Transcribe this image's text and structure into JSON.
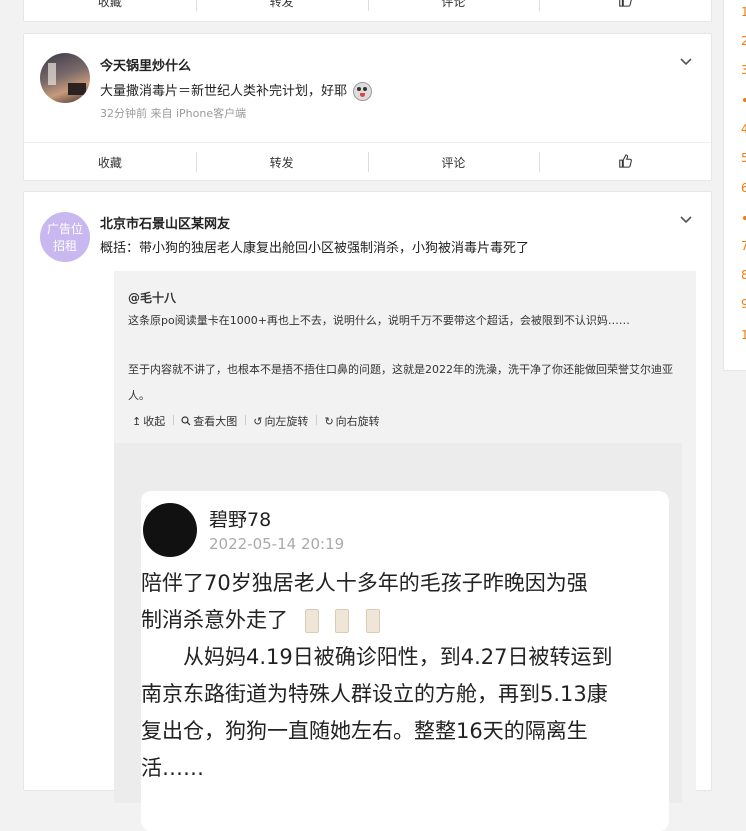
{
  "top_card": {
    "actions": [
      "收藏",
      "转发",
      "评论"
    ]
  },
  "post1": {
    "author": "今天锅里炒什么",
    "text": "大量撒消毒片＝新世纪人类补完计划，好耶",
    "meta": "32分钟前  来自 iPhone客户端",
    "actions": [
      "收藏",
      "转发",
      "评论"
    ]
  },
  "post2": {
    "author": "北京市石景山区某网友",
    "avatar_badge": "广告位招租",
    "text": "概括：带小狗的独居老人康复出舱回小区被强制消杀，小狗被消毒片毒死了",
    "repost": {
      "author": "@毛十八",
      "line1": "这条原po阅读量卡在1000+再也上不去，说明什么，说明千万不要带这个超话，会被限到不认识妈……",
      "line2": "至于内容就不讲了，也根本不是捂不捂住口鼻的问题，这就是2022年的洗澡，洗干净了你还能做回荣誉艾尔迪亚人。",
      "toolbar": [
        "收起",
        "查看大图",
        "向左旋转",
        "向右旋转"
      ],
      "image": {
        "name": "碧野78",
        "time": "2022-05-14 20:19",
        "body_line1": "陪伴了70岁独居老人十多年的毛孩子昨晚因为强",
        "body_line2": "制消杀意外走了",
        "body_line3": "　　从妈妈4.19日被确诊阳性，到4.27日被转运到",
        "body_line4": "南京东路街道为特殊人群设立的方舱，再到5.13康",
        "body_line5": "复出仓，狗狗一直随她左右。整整16天的隔离生",
        "body_line6": "活……"
      }
    }
  },
  "sidebar": {
    "numbers": [
      "1",
      "2",
      "3",
      "4",
      "5",
      "6",
      "7",
      "8",
      "9",
      "1"
    ]
  },
  "colors": {
    "accent": "#f77b00",
    "badge": "#c9b8f0"
  }
}
